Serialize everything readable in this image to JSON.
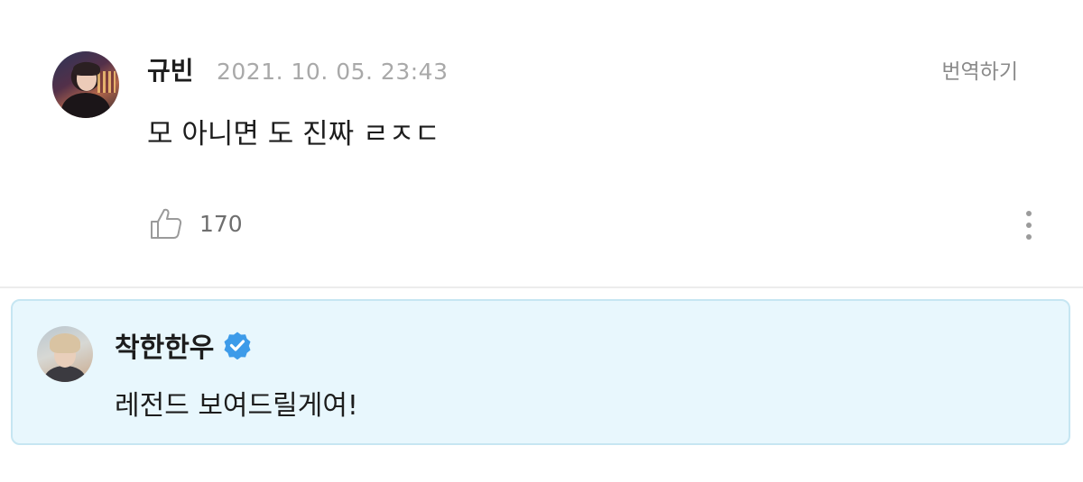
{
  "comment": {
    "username": "규빈",
    "timestamp": "2021. 10. 05. 23:43",
    "translate_label": "번역하기",
    "body": "모 아니면 도 진짜 ㄹㅈㄷ",
    "likes": "170",
    "icons": {
      "like": "thumbs-up-icon",
      "more": "more-vertical-icon"
    }
  },
  "reply": {
    "username": "착한한우",
    "verified": true,
    "body": "레전드 보여드릴게여!",
    "icons": {
      "verified": "verified-badge-icon"
    }
  },
  "colors": {
    "reply_background": "#e8f7fd",
    "reply_border": "#c6e6f2",
    "verified_badge": "#3d9be9",
    "timestamp": "#a9a9a9"
  }
}
